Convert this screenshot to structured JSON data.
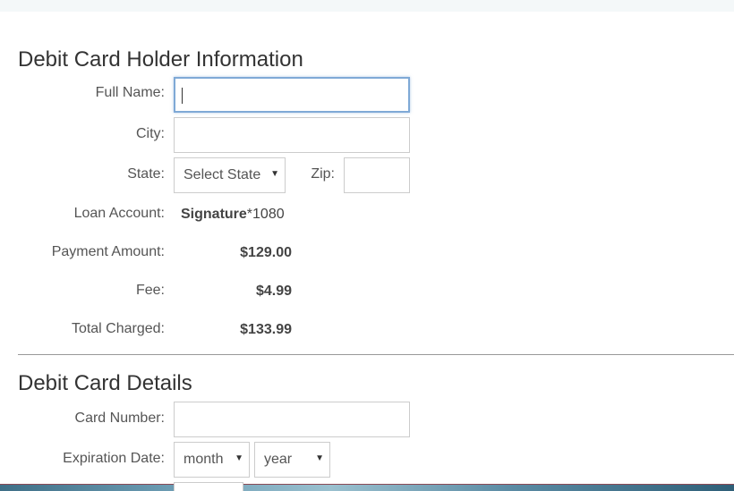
{
  "holder_section": {
    "title": "Debit Card Holder Information",
    "full_name_label": "Full Name:",
    "full_name_value": "",
    "city_label": "City:",
    "city_value": "",
    "state_label": "State:",
    "state_selected": "Select State",
    "zip_label": "Zip:",
    "zip_value": "",
    "loan_account_label": "Loan Account:",
    "loan_account_name": "Signature",
    "loan_account_suffix": "*1080",
    "payment_amount_label": "Payment Amount:",
    "payment_amount_value": "$129.00",
    "fee_label": "Fee:",
    "fee_value": "$4.99",
    "total_label": "Total Charged:",
    "total_value": "$133.99"
  },
  "card_section": {
    "title": "Debit Card Details",
    "card_number_label": "Card Number:",
    "card_number_value": "",
    "expiration_label": "Expiration Date:",
    "month_selected": "month",
    "year_selected": "year"
  },
  "colors": {
    "focus_border": "#7fa9d6",
    "divider": "#999999"
  }
}
